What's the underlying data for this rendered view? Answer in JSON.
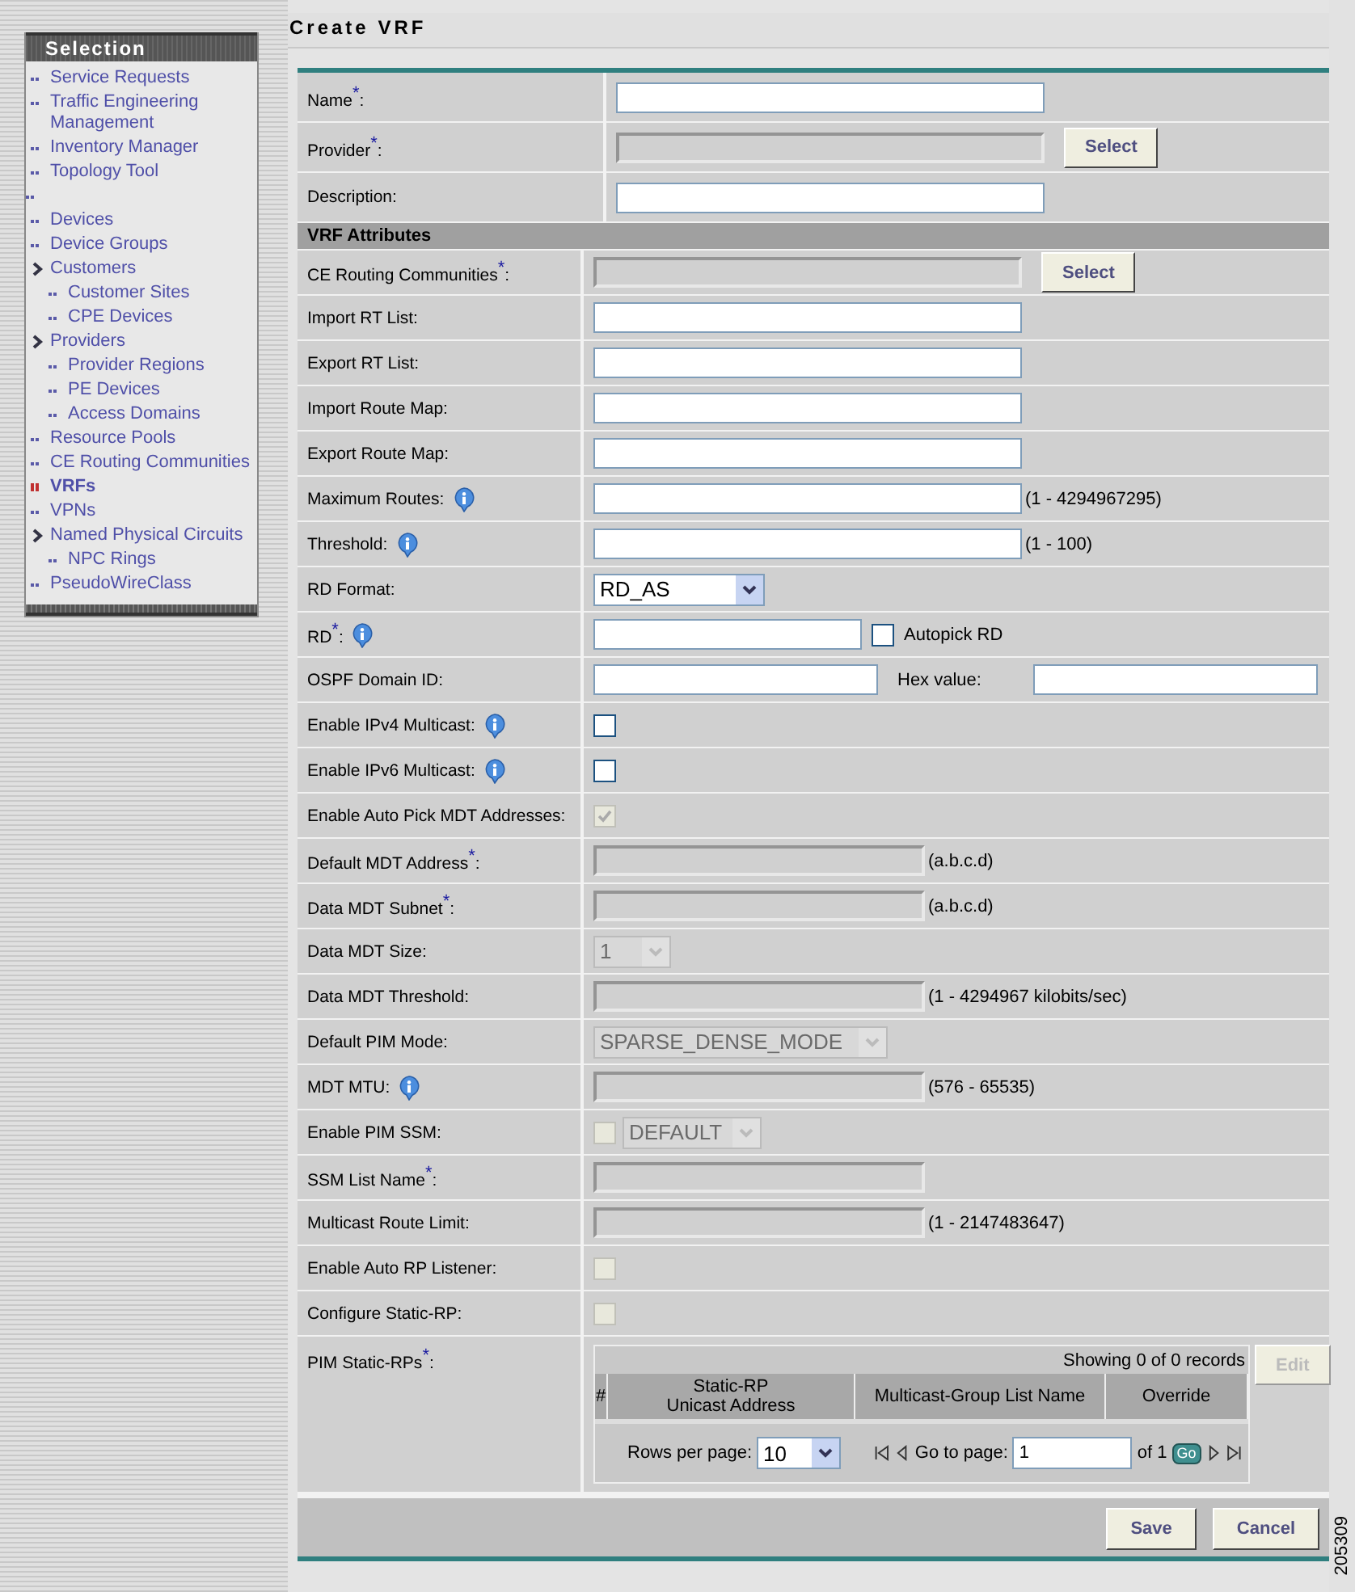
{
  "sidebar": {
    "title": "Selection",
    "items": [
      {
        "label": "Service Requests",
        "selected": false
      },
      {
        "label": "Traffic Engineering Management",
        "selected": false
      },
      {
        "label": "Inventory Manager",
        "selected": false
      },
      {
        "label": "Topology Tool",
        "selected": false
      },
      {
        "kind": "blank",
        "selected": false
      },
      {
        "label": "Devices",
        "selected": false
      },
      {
        "label": "Device Groups",
        "selected": false
      },
      {
        "label": "Customers",
        "selected": false,
        "children": [
          {
            "label": "Customer Sites",
            "selected": false
          },
          {
            "label": "CPE Devices",
            "selected": false
          }
        ]
      },
      {
        "label": "Providers",
        "selected": false,
        "children": [
          {
            "label": "Provider Regions",
            "selected": false
          },
          {
            "label": "PE Devices",
            "selected": false
          },
          {
            "label": "Access Domains",
            "selected": false
          }
        ]
      },
      {
        "label": "Resource Pools",
        "selected": false
      },
      {
        "label": "CE Routing Communities",
        "selected": false
      },
      {
        "label": "VRFs",
        "selected": true
      },
      {
        "label": "VPNs",
        "selected": false
      },
      {
        "label": "Named Physical Circuits",
        "selected": false,
        "children": [
          {
            "label": "NPC Rings",
            "selected": false
          }
        ]
      },
      {
        "label": "PseudoWireClass",
        "selected": false
      }
    ]
  },
  "title": "Create VRF",
  "general_rows": [
    {
      "kind": "input",
      "label": "Name$^{*}$:",
      "disabled": false
    },
    {
      "kind": "input",
      "label": "Provider$^{*}$:",
      "disabled": true,
      "button": "Select"
    },
    {
      "kind": "input",
      "label": "Description:",
      "disabled": false
    }
  ],
  "section_title": "VRF Attributes",
  "vrf_rows": [
    {
      "kind": "input",
      "label": "CE Routing Communities$^{*}$:",
      "disabled": true,
      "button": "Select"
    },
    {
      "kind": "input",
      "label": "Import RT List:",
      "disabled": false
    },
    {
      "kind": "input",
      "label": "Export RT List:",
      "disabled": false
    },
    {
      "kind": "input",
      "label": "Import Route Map:",
      "disabled": false
    },
    {
      "kind": "input",
      "label": "Export Route Map:",
      "disabled": false
    },
    {
      "kind": "input",
      "label": "Maximum Routes:",
      "info": true,
      "disabled": false,
      "hint": "(1 - 4294967295)"
    },
    {
      "kind": "input",
      "label": "Threshold:",
      "info": true,
      "disabled": false,
      "hint": "(1 - 100)"
    },
    {
      "kind": "select",
      "label": "RD Format:",
      "disabled": false,
      "value": "RD_AS"
    },
    {
      "kind": "input_checkbox",
      "label": "RD$^{*}$:",
      "info": true,
      "disabled": false,
      "checked": false,
      "checkbox_label": "Autopick RD"
    },
    {
      "kind": "input_pair",
      "label": "OSPF Domain ID:",
      "disabled": false,
      "second_label": "Hex value:"
    },
    {
      "kind": "checkbox",
      "label": "Enable IPv4 Multicast:",
      "info": true,
      "disabled": false,
      "checked": false
    },
    {
      "kind": "checkbox",
      "label": "Enable IPv6 Multicast:",
      "info": true,
      "disabled": false,
      "checked": false
    },
    {
      "kind": "checkbox",
      "label": "Enable Auto Pick MDT Addresses:",
      "disabled": true,
      "checked": true
    },
    {
      "kind": "input",
      "label": "Default MDT Address$^{*}$:",
      "disabled": true,
      "hint": "(a.b.c.d)"
    },
    {
      "kind": "input",
      "label": "Data MDT Subnet$^{*}$:",
      "disabled": true,
      "hint": "(a.b.c.d)"
    },
    {
      "kind": "select",
      "label": "Data MDT Size:",
      "disabled": true,
      "value": "1"
    },
    {
      "kind": "input",
      "label": "Data MDT Threshold:",
      "disabled": true,
      "hint": "(1 - 4294967 kilobits/sec)"
    },
    {
      "kind": "select",
      "label": "Default PIM Mode:",
      "disabled": true,
      "value": "SPARSE_DENSE_MODE"
    },
    {
      "kind": "input",
      "label": "MDT MTU:",
      "info": true,
      "disabled": true,
      "hint": "(576 - 65535)"
    },
    {
      "kind": "checkbox_select",
      "label": "Enable PIM SSM:",
      "disabled": true,
      "checked": false,
      "value": "DEFAULT"
    },
    {
      "kind": "input",
      "label": "SSM List Name$^{*}$:",
      "disabled": true
    },
    {
      "kind": "input",
      "label": "Multicast Route Limit:",
      "disabled": true,
      "hint": "(1 - 2147483647)"
    },
    {
      "kind": "checkbox",
      "label": "Enable Auto RP Listener:",
      "disabled": true,
      "checked": false
    },
    {
      "kind": "checkbox",
      "label": "Configure Static-RP:",
      "disabled": true,
      "checked": false
    },
    {
      "kind": "table",
      "label": "PIM Static-RPs$^{*}$:",
      "table": {
        "summary": "Showing 0 of 0 records",
        "edit_button": "Edit",
        "edit_disabled": true,
        "columns": [
          "#",
          "Static-RP\nUnicast Address",
          "Multicast-Group List Name",
          "Override"
        ],
        "rows_per_page_label": "Rows per page:",
        "rows_per_page": "10",
        "go_to_label": "Go to page:",
        "page": "1",
        "of_pages": "of 1",
        "go_button": "Go"
      }
    }
  ],
  "buttons": [
    "Save",
    "Cancel"
  ],
  "figure_number": "205309"
}
